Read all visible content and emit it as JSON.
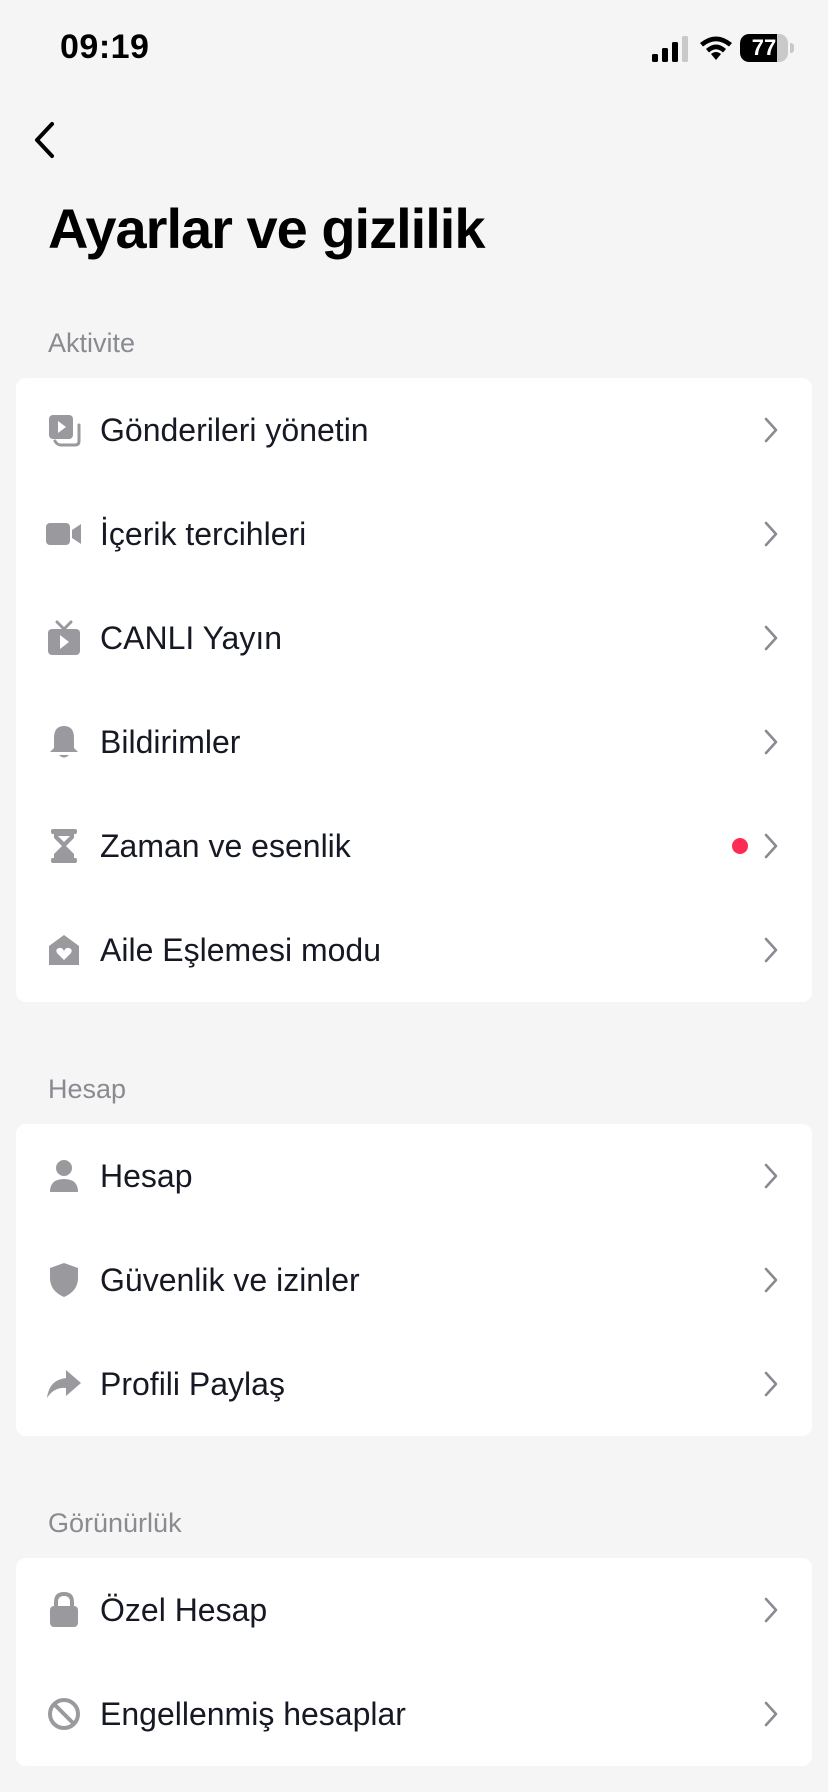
{
  "status_bar": {
    "time": "09:19",
    "battery": "77",
    "battery_level": 0.77
  },
  "colors": {
    "icon": "#9a9a9e",
    "chevron": "#8a8b91",
    "notification_dot": "#fe2c55",
    "background": "#f5f5f5"
  },
  "header": {
    "back_icon": "chevron-left-icon",
    "title": "Ayarlar ve gizlilik"
  },
  "sections": {
    "activity": {
      "label": "Aktivite",
      "items": [
        {
          "label": "Gönderileri yönetin",
          "icon": "posts-icon"
        },
        {
          "label": "İçerik tercihleri",
          "icon": "video-camera-icon"
        },
        {
          "label": "CANLI Yayın",
          "icon": "live-tv-icon"
        },
        {
          "label": "Bildirimler",
          "icon": "bell-icon"
        },
        {
          "label": "Zaman ve esenlik",
          "icon": "hourglass-icon",
          "has_dot": true
        },
        {
          "label": "Aile Eşlemesi modu",
          "icon": "home-heart-icon"
        }
      ]
    },
    "account": {
      "label": "Hesap",
      "items": [
        {
          "label": "Hesap",
          "icon": "person-icon"
        },
        {
          "label": "Güvenlik ve izinler",
          "icon": "shield-icon"
        },
        {
          "label": "Profili Paylaş",
          "icon": "share-arrow-icon"
        }
      ]
    },
    "visibility": {
      "label": "Görünürlük",
      "items": [
        {
          "label": "Özel Hesap",
          "icon": "lock-icon"
        },
        {
          "label": "Engellenmiş hesaplar",
          "icon": "blocked-icon"
        }
      ]
    }
  }
}
